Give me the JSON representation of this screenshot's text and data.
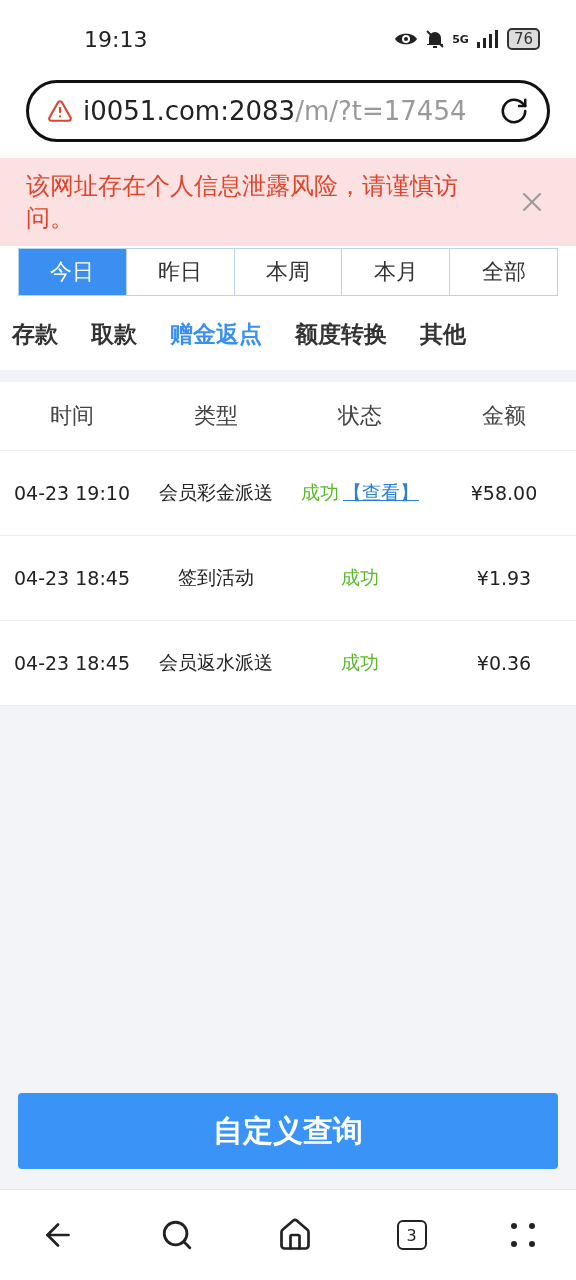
{
  "status_bar": {
    "time": "19:13",
    "network": "5G",
    "battery": "76"
  },
  "address_bar": {
    "domain": "i0051.com:2083",
    "path": "/m/?t=17454"
  },
  "warning": {
    "text": "该网址存在个人信息泄露风险，请谨慎访问。"
  },
  "date_tabs": [
    {
      "label": "今日",
      "selected": true
    },
    {
      "label": "昨日",
      "selected": false
    },
    {
      "label": "本周",
      "selected": false
    },
    {
      "label": "本月",
      "selected": false
    },
    {
      "label": "全部",
      "selected": false
    }
  ],
  "category_tabs": [
    {
      "label": "存款",
      "selected": false
    },
    {
      "label": "取款",
      "selected": false
    },
    {
      "label": "赠金返点",
      "selected": true
    },
    {
      "label": "额度转换",
      "selected": false
    },
    {
      "label": "其他",
      "selected": false
    }
  ],
  "table": {
    "columns": [
      "时间",
      "类型",
      "状态",
      "金额"
    ],
    "rows": [
      {
        "time": "04-23 19:10",
        "type": "会员彩金派送",
        "status": "成功",
        "link": "【查看】",
        "amount": "¥58.00"
      },
      {
        "time": "04-23 18:45",
        "type": "签到活动",
        "status": "成功",
        "amount": "¥1.93"
      },
      {
        "time": "04-23 18:45",
        "type": "会员返水派送",
        "status": "成功",
        "amount": "¥0.36"
      }
    ]
  },
  "query_button": "自定义查询",
  "bottom_nav": {
    "tab_count": "3"
  }
}
